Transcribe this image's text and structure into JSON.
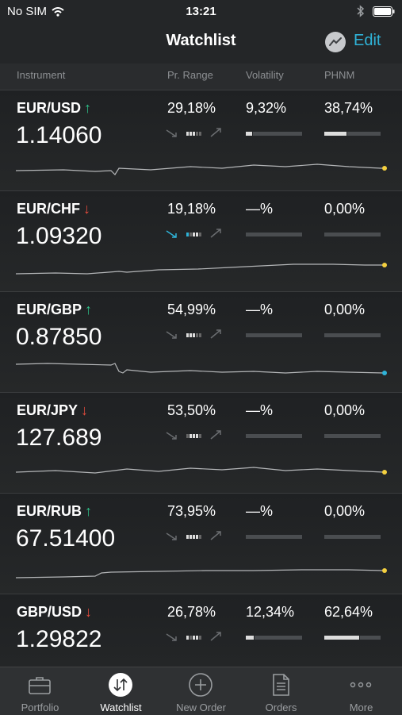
{
  "status_bar": {
    "carrier": "No SIM",
    "time": "13:21"
  },
  "nav": {
    "title": "Watchlist",
    "edit_label": "Edit"
  },
  "columns": {
    "instrument": "Instrument",
    "pr_range": "Pr. Range",
    "volatility": "Volatility",
    "phnm": "PHNM"
  },
  "colors": {
    "accent": "#2fb3d8",
    "up": "#2fc28a",
    "down": "#e74c3c",
    "last_yellow": "#f4d03f",
    "last_cyan": "#2fb3d8"
  },
  "rows": [
    {
      "symbol": "EUR/USD",
      "direction": "↑",
      "price": "1.14060",
      "pr_range": "29,18%",
      "volatility": "9,32%",
      "phnm": "38,74%"
    },
    {
      "symbol": "EUR/CHF",
      "direction": "↓",
      "price": "1.09320",
      "pr_range": "19,18%",
      "volatility": "—%",
      "phnm": "0,00%"
    },
    {
      "symbol": "EUR/GBP",
      "direction": "↑",
      "price": "0.87850",
      "pr_range": "54,99%",
      "volatility": "—%",
      "phnm": "0,00%"
    },
    {
      "symbol": "EUR/JPY",
      "direction": "↓",
      "price": "127.689",
      "pr_range": "53,50%",
      "volatility": "—%",
      "phnm": "0,00%"
    },
    {
      "symbol": "EUR/RUB",
      "direction": "↑",
      "price": "67.51400",
      "pr_range": "73,95%",
      "volatility": "—%",
      "phnm": "0,00%"
    },
    {
      "symbol": "GBP/USD",
      "direction": "↓",
      "price": "1.29822",
      "pr_range": "26,78%",
      "volatility": "12,34%",
      "phnm": "62,64%"
    }
  ],
  "tabs": [
    {
      "label": "Portfolio",
      "icon": "briefcase-icon"
    },
    {
      "label": "Watchlist",
      "icon": "updown-arrows-icon"
    },
    {
      "label": "New Order",
      "icon": "plus-circle-icon"
    },
    {
      "label": "Orders",
      "icon": "document-icon"
    },
    {
      "label": "More",
      "icon": "ellipsis-icon"
    }
  ]
}
